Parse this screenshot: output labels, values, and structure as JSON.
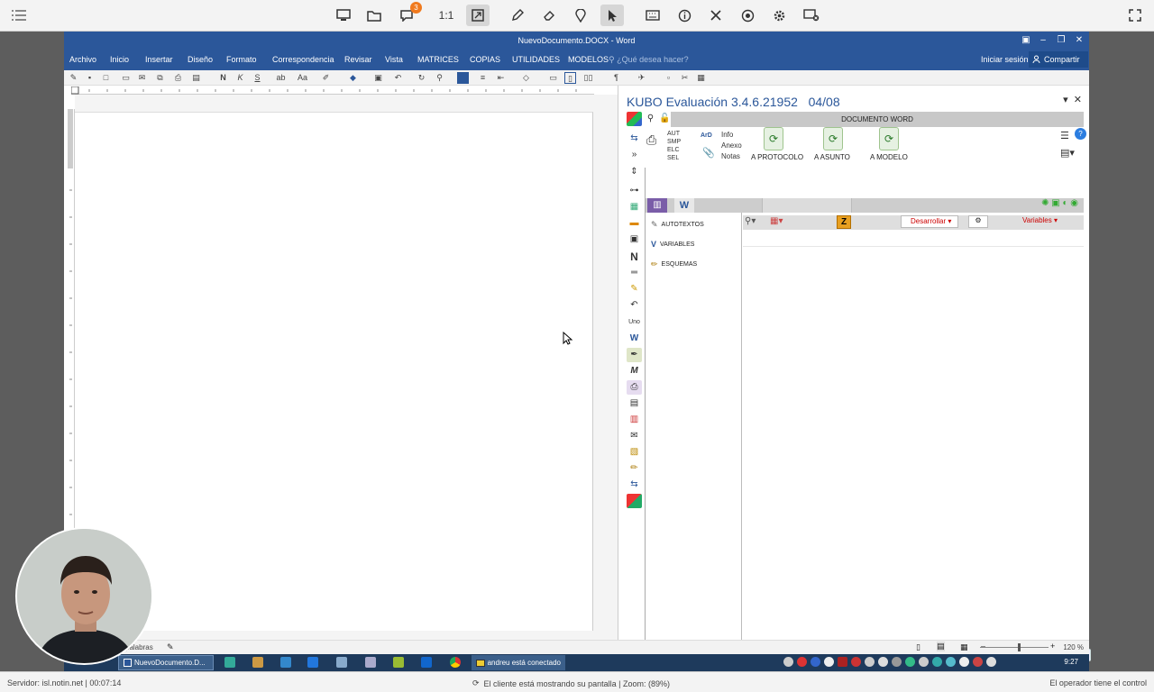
{
  "rc_toolbar": {
    "ratio_label": "1:1",
    "chat_badge": "3",
    "icons": [
      "menu-icon",
      "monitor-icon",
      "folder-icon",
      "chat-icon",
      "ratio-icon",
      "fit-screen-icon",
      "pen-icon",
      "eraser-icon",
      "pin-icon",
      "pointer-icon",
      "keyboard-icon",
      "info-icon",
      "tools-icon",
      "record-icon",
      "settings-icon",
      "disconnect-screen-icon",
      "fullscreen-icon"
    ]
  },
  "word": {
    "title": "NuevoDocumento.DOCX - Word",
    "tabs": [
      "Archivo",
      "Inicio",
      "Insertar",
      "Diseño",
      "Formato",
      "Correspondencia",
      "Revisar",
      "Vista",
      "MATRICES",
      "COPIAS",
      "UTILIDADES",
      "MODELOS"
    ],
    "tell_me": "¿Qué desea hacer?",
    "sign_in": "Iniciar sesión",
    "share": "Compartir",
    "status_words": "palabras",
    "zoom": "120 %"
  },
  "kubo": {
    "title": "KUBO Evaluación 3.4.6.21952",
    "date": "04/08",
    "header": "DOCUMENTO WORD",
    "mini_labels": [
      "AUT",
      "SMP",
      "ELC",
      "SEL"
    ],
    "ard_label": "ArD",
    "info_labels": [
      "Info",
      "Anexo",
      "Notas"
    ],
    "actions": [
      "A PROTOCOLO",
      "A ASUNTO",
      "A MODELO"
    ],
    "list_items": [
      "AUTOTEXTOS",
      "VARIABLES",
      "ESQUEMAS"
    ],
    "develop_label": "Desarrollar",
    "variables_label": "Variables"
  },
  "taskbar": {
    "word_item": "NuevoDocumento.D...",
    "connected_item": "andreu está conectado",
    "clock": "9:27"
  },
  "rc_status": {
    "server": "Servidor: isl.notin.net | 00:07:14",
    "center": "El cliente está mostrando su pantalla | Zoom: (89%)",
    "right": "El operador tiene el control"
  },
  "colors": {
    "word_blue": "#2b579a",
    "badge_orange": "#f07a1e",
    "taskbar": "#1e3a5c"
  }
}
